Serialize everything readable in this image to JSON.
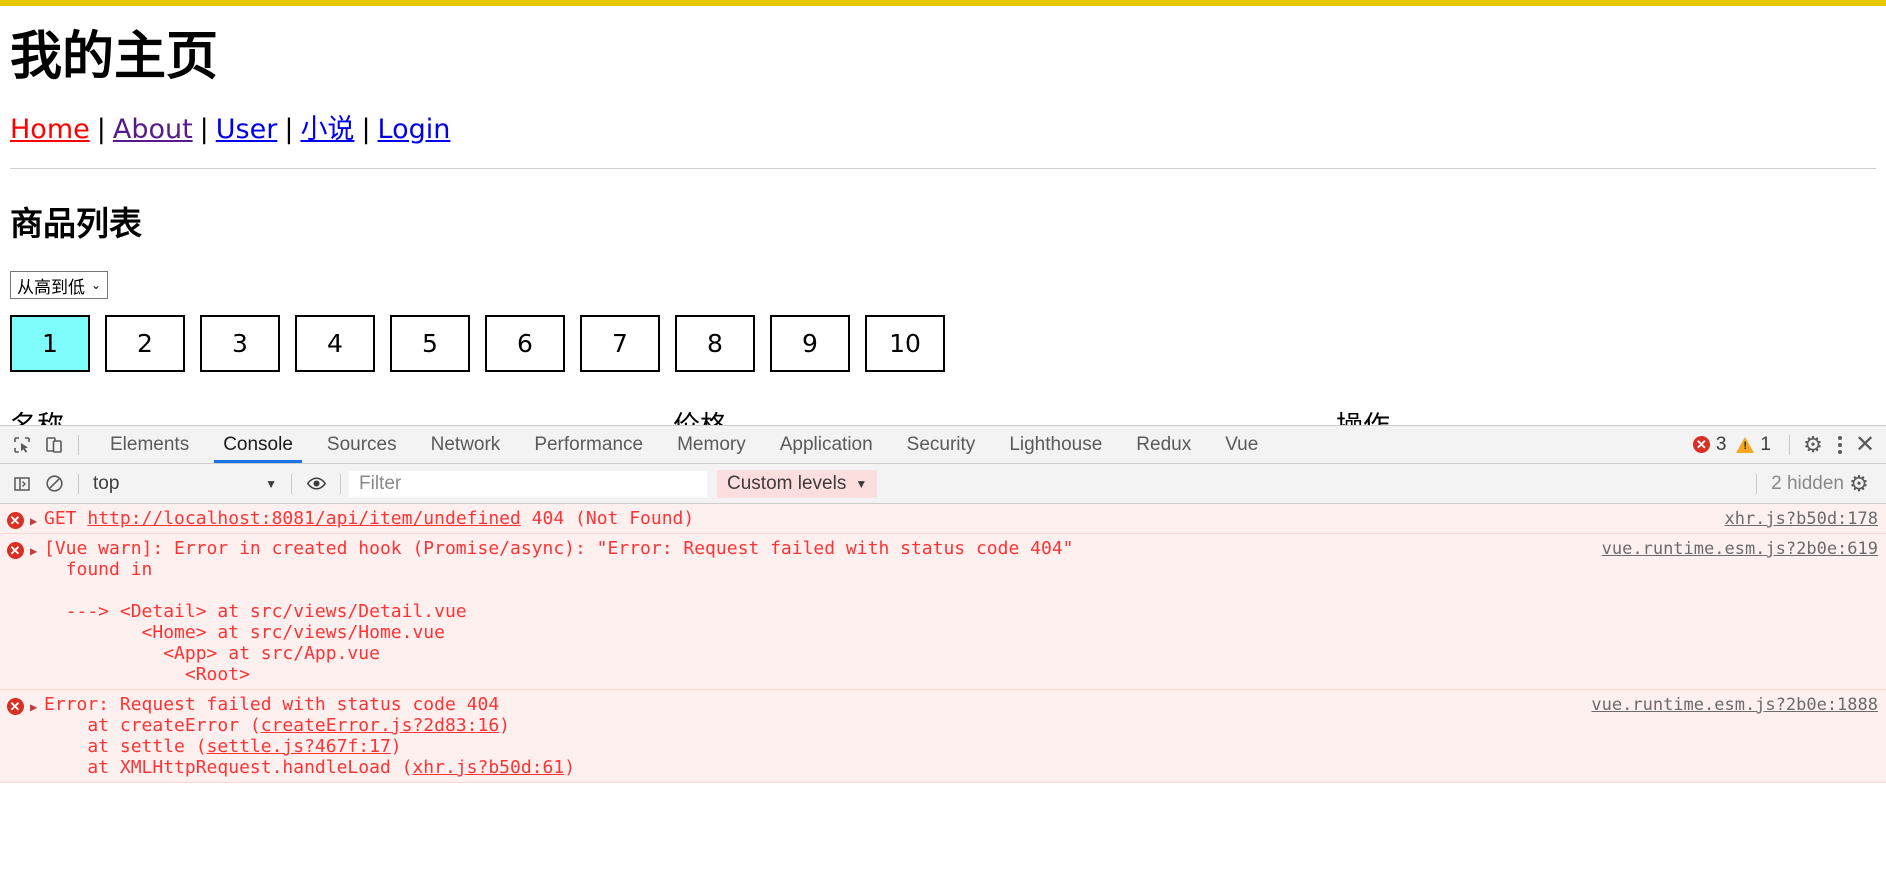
{
  "page": {
    "title": "我的主页",
    "nav": [
      {
        "label": "Home",
        "cls": "nav-home"
      },
      {
        "label": "About",
        "cls": "nav-about"
      },
      {
        "label": "User",
        "cls": "nav-user"
      },
      {
        "label": "小说",
        "cls": "nav-novel"
      },
      {
        "label": "Login",
        "cls": "nav-login"
      }
    ],
    "nav_separator": "|",
    "section_title": "商品列表",
    "sort": {
      "selected": "从高到低",
      "caret": "⌄"
    },
    "pagination": {
      "pages": [
        "1",
        "2",
        "3",
        "4",
        "5",
        "6",
        "7",
        "8",
        "9",
        "10"
      ],
      "active": "1",
      "active_color": "#7ffdfd"
    },
    "occluded_labels": [
      "名称",
      "价格",
      "操作"
    ]
  },
  "devtools": {
    "tabs": [
      "Elements",
      "Console",
      "Sources",
      "Network",
      "Performance",
      "Memory",
      "Application",
      "Security",
      "Lighthouse",
      "Redux",
      "Vue"
    ],
    "active_tab": "Console",
    "inspect_icon": "inspect-element-icon",
    "device_icon": "device-toolbar-icon",
    "counts": {
      "errors": "3",
      "warnings": "1",
      "error_color": "#d93025",
      "warning_color": "#f5a623"
    },
    "settings_icon": "⚙",
    "kebab_icon": "more-options-icon",
    "close_icon": "✕",
    "filterbar": {
      "sidebar_toggle_icon": "console-sidebar-icon",
      "clear_icon": "clear-console-icon",
      "context": "top",
      "context_caret": "▼",
      "eye_icon": "live-expression-icon",
      "filter_placeholder": "Filter",
      "filter_value": "",
      "levels_label": "Custom levels",
      "levels_caret": "▼",
      "levels_bg": "#fddede",
      "hidden_count": "2 hidden",
      "settings_icon": "⚙"
    },
    "messages": [
      {
        "icon": "error-icon",
        "arrow": "▶",
        "pre": "GET ",
        "link": "http://localhost:8081/api/item/undefined",
        "post": " 404 (Not Found)",
        "source": "xhr.js?b50d:178"
      },
      {
        "icon": "error-icon",
        "arrow": "▶",
        "pre": "[Vue warn]: Error in created hook (Promise/async): \"Error: Request failed with status code 404\"",
        "link": "",
        "post": "",
        "source": "vue.runtime.esm.js?2b0e:619",
        "extra": "\n  found in\n\n  ---> <Detail> at src/views/Detail.vue\n         <Home> at src/views/Home.vue\n           <App> at src/App.vue\n             <Root>"
      },
      {
        "icon": "error-icon",
        "arrow": "▶",
        "pre": "Error: Request failed with status code 404",
        "link": "",
        "post": "",
        "source": "vue.runtime.esm.js?2b0e:1888",
        "stack": [
          {
            "prefix": "    at createError (",
            "link": "createError.js?2d83:16",
            "suffix": ")"
          },
          {
            "prefix": "    at settle (",
            "link": "settle.js?467f:17",
            "suffix": ")"
          },
          {
            "prefix": "    at XMLHttpRequest.handleLoad (",
            "link": "xhr.js?b50d:61",
            "suffix": ")"
          }
        ]
      }
    ]
  }
}
